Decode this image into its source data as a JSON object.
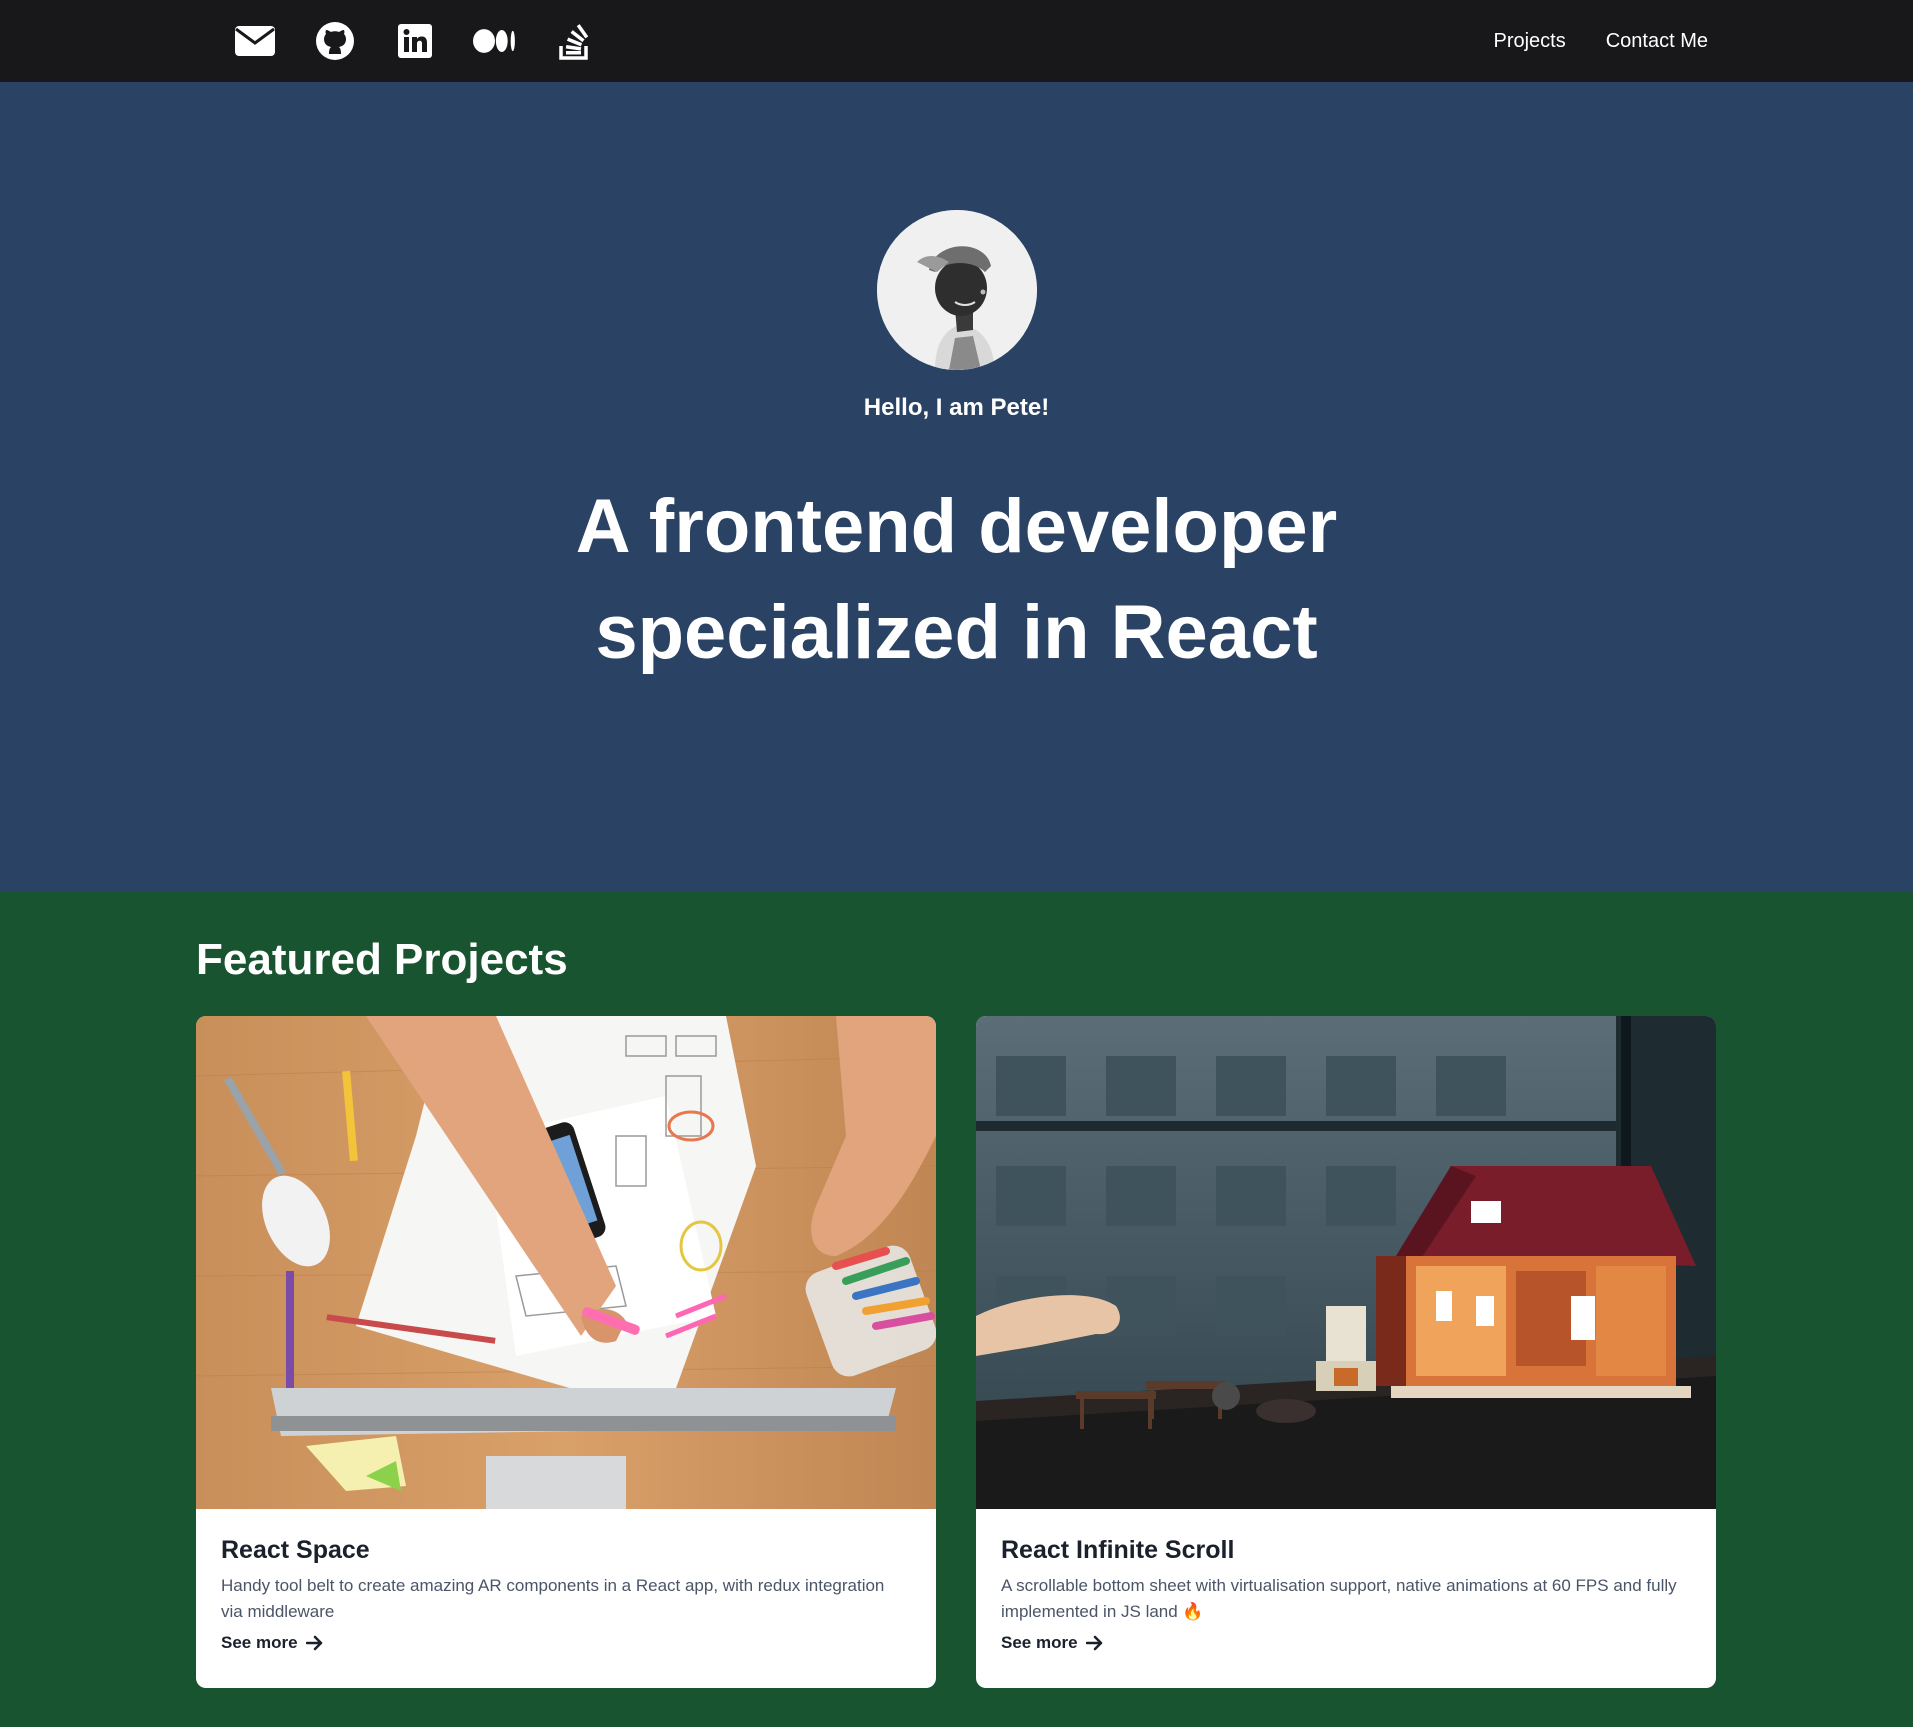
{
  "nav": {
    "socials": [
      {
        "icon": "envelope-icon"
      },
      {
        "icon": "github-icon"
      },
      {
        "icon": "linkedin-icon"
      },
      {
        "icon": "medium-icon"
      },
      {
        "icon": "stackoverflow-icon"
      }
    ],
    "links": [
      "Projects",
      "Contact Me"
    ]
  },
  "hero": {
    "greeting": "Hello, I am Pete!",
    "headline_line1": "A frontend developer",
    "headline_line2": "specialized in React"
  },
  "projects": {
    "title": "Featured Projects",
    "cards": [
      {
        "title": "React Space",
        "description": "Handy tool belt to create amazing AR components in a React app, with redux integration via middleware",
        "cta": "See more"
      },
      {
        "title": "React Infinite Scroll",
        "description": "A scrollable bottom sheet with virtualisation support, native animations at 60 FPS and fully implemented in JS land 🔥",
        "cta": "See more"
      }
    ]
  },
  "colors": {
    "nav_bg": "#18181b",
    "hero_bg": "#2a4365",
    "projects_bg": "#18542f",
    "card_bg": "#ffffff"
  }
}
